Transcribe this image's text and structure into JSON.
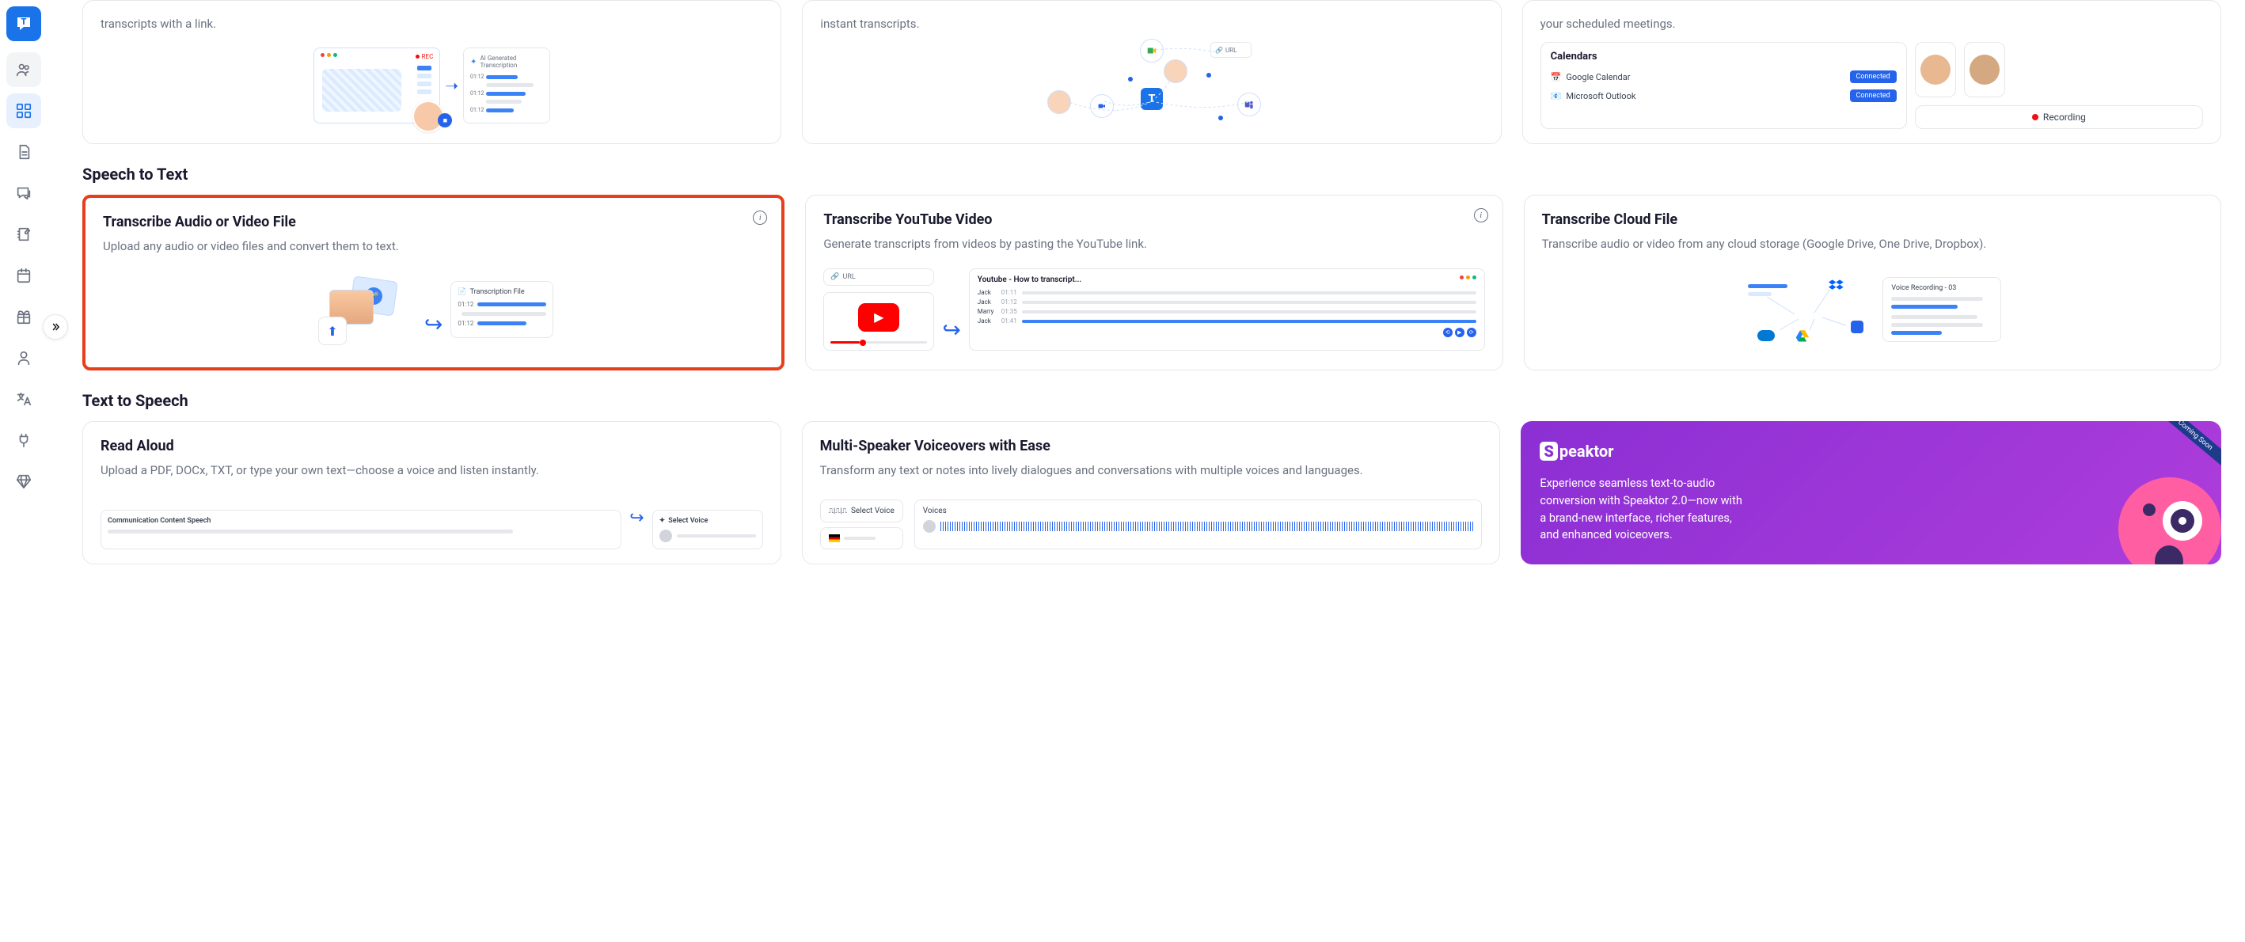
{
  "row1": {
    "card1": {
      "desc": "transcripts with a link.",
      "trans_header": "AI Generated Transcription",
      "rec": "REC",
      "t1": "01:12",
      "t2": "01:12",
      "t3": "01:12"
    },
    "card2": {
      "desc": "instant transcripts.",
      "url": "URL"
    },
    "card3": {
      "desc": "your scheduled meetings.",
      "calendars_title": "Calendars",
      "google": "Google Calendar",
      "outlook": "Microsoft Outlook",
      "connected": "Connected",
      "recording": "Recording"
    }
  },
  "section_stt": "Speech to Text",
  "stt": {
    "card1": {
      "title": "Transcribe Audio or Video File",
      "desc": "Upload any audio or video files and convert them to text.",
      "file_label": "Transcription File",
      "t1": "01:12",
      "t2": "01:12"
    },
    "card2": {
      "title": "Transcribe YouTube Video",
      "desc": "Generate transcripts from videos by pasting the YouTube link.",
      "url": "URL",
      "panel_title": "Youtube - How to transcript...",
      "rows": [
        {
          "name": "Jack",
          "time": "01:11"
        },
        {
          "name": "Jack",
          "time": "01:12"
        },
        {
          "name": "Marry",
          "time": "01:35"
        },
        {
          "name": "Jack",
          "time": "01:41"
        }
      ]
    },
    "card3": {
      "title": "Transcribe Cloud File",
      "desc": "Transcribe audio or video from any cloud storage (Google Drive, One Drive, Dropbox).",
      "panel_title": "Voice Recording - 03"
    }
  },
  "section_tts": "Text to Speech",
  "tts": {
    "card1": {
      "title": "Read Aloud",
      "desc": "Upload a PDF, DOCx, TXT, or type your own text—choose a voice and listen instantly.",
      "panel1": "Communication Content Speech",
      "panel2": "Select Voice"
    },
    "card2": {
      "title": "Multi-Speaker Voiceovers with Ease",
      "desc": "Transform any text or notes into lively dialogues and conversations with multiple voices and languages.",
      "select": "Select Voice",
      "voices": "Voices"
    },
    "speaktor": {
      "brand_rest": "peaktor",
      "badge": "Coming Soon",
      "desc": "Experience seamless text-to-audio conversion with Speaktor 2.0—now with a brand-new interface, richer features, and enhanced voiceovers."
    }
  }
}
